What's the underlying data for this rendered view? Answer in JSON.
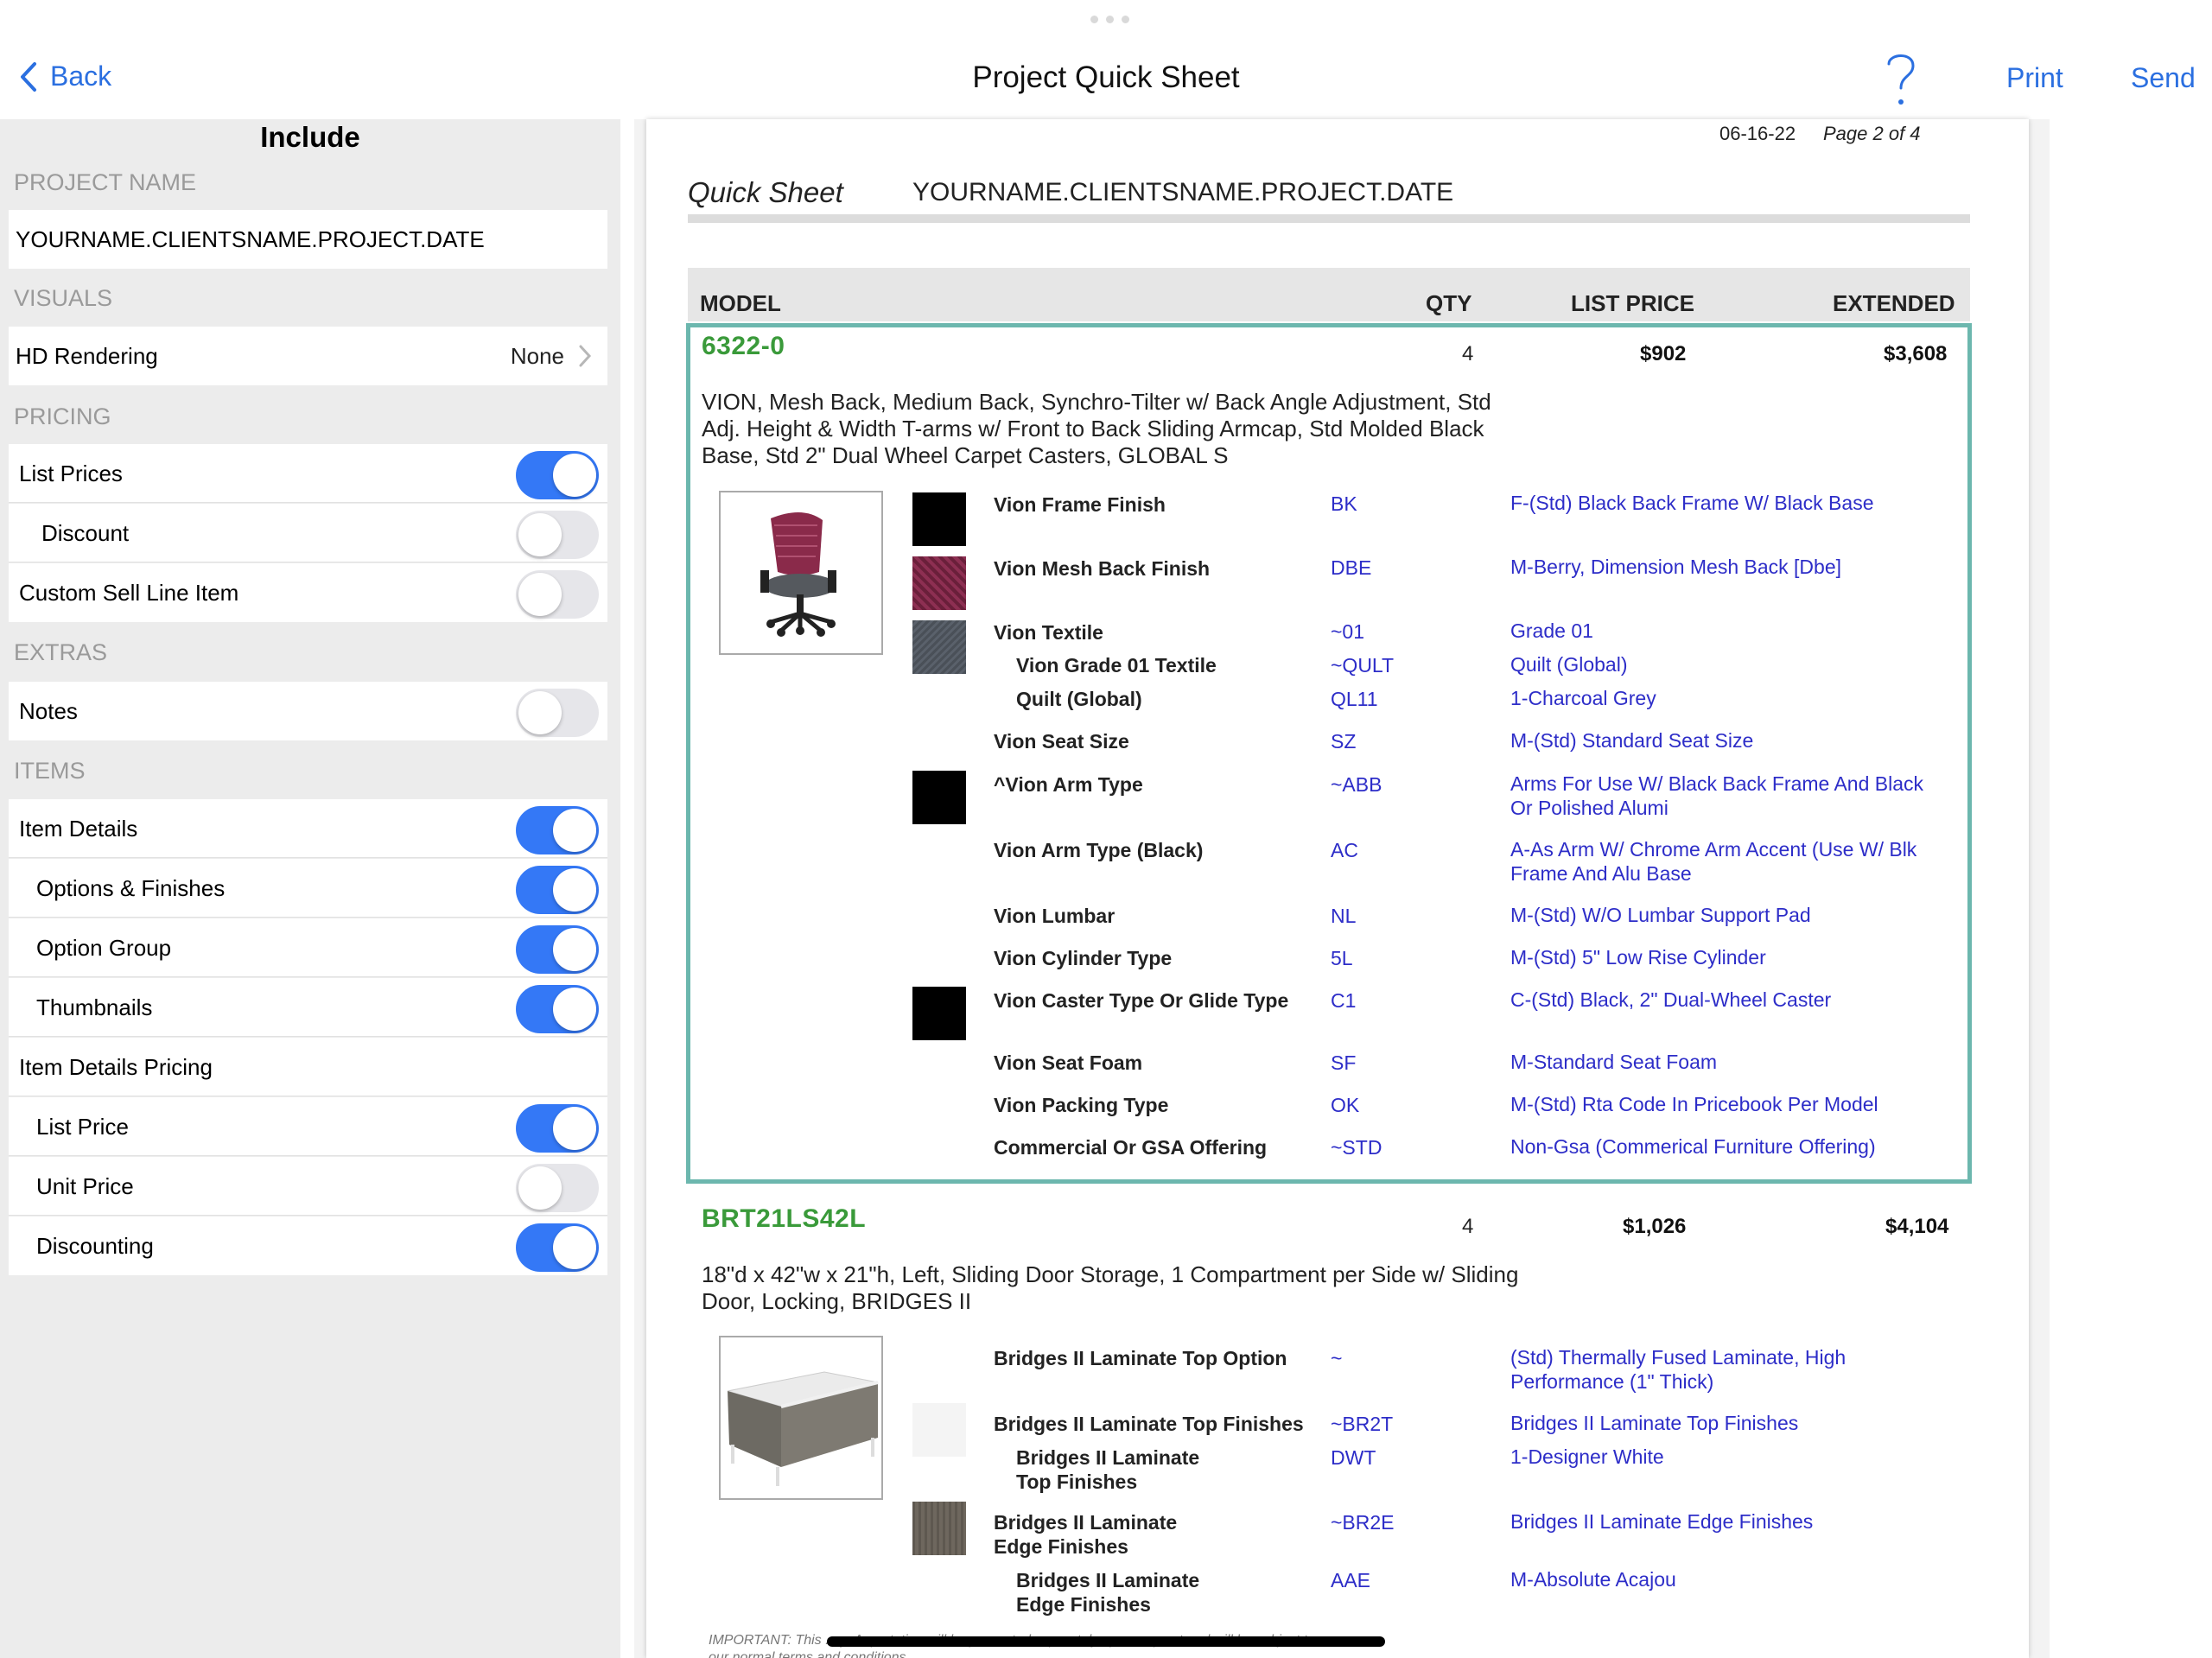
{
  "nav": {
    "back_label": "Back",
    "title": "Project Quick Sheet",
    "help_label": "?",
    "print_label": "Print",
    "send_label": "Send"
  },
  "panel": {
    "title": "Include",
    "project_name_header": "PROJECT NAME",
    "project_name": "YOURNAME.CLIENTSNAME.PROJECT.DATE",
    "visuals_header": "VISUALS",
    "hd_rendering_label": "HD Rendering",
    "hd_rendering_value": "None",
    "pricing_header": "PRICING",
    "list_prices_label": "List Prices",
    "list_prices_on": true,
    "discount_label": "Discount",
    "discount_on": false,
    "custom_sell_label": "Custom Sell Line Item",
    "custom_sell_on": false,
    "extras_header": "EXTRAS",
    "notes_label": "Notes",
    "notes_on": false,
    "items_header": "ITEMS",
    "item_details_label": "Item Details",
    "item_details_on": true,
    "options_finishes_label": "Options & Finishes",
    "options_finishes_on": true,
    "option_group_label": "Option Group",
    "option_group_on": true,
    "thumbnails_label": "Thumbnails",
    "thumbnails_on": true,
    "item_details_pricing_label": "Item Details Pricing",
    "list_price_label": "List Price",
    "list_price_on": true,
    "unit_price_label": "Unit Price",
    "unit_price_on": false,
    "discounting_label": "Discounting",
    "discounting_on": true
  },
  "doc": {
    "date": "06-16-22",
    "page": "Page 2 of 4",
    "qs_label": "Quick Sheet",
    "qs_name": "YOURNAME.CLIENTSNAME.PROJECT.DATE",
    "col_model": "MODEL",
    "col_qty": "QTY",
    "col_list": "LIST PRICE",
    "col_ext": "EXTENDED",
    "item1": {
      "model": "6322-0",
      "qty": "4",
      "list": "$902",
      "ext": "$3,608",
      "desc1": "VION, Mesh Back, Medium Back, Synchro-Tilter w/ Back Angle Adjustment, Std",
      "desc2": "Adj. Height & Width T-arms w/ Front to Back Sliding Armcap, Std Molded Black",
      "desc3": "Base, Std 2\" Dual Wheel Carpet Casters, GLOBAL S",
      "opts": [
        {
          "name": "Vion Frame Finish",
          "code": "BK",
          "val": "F-(Std) Black Back Frame W/ Black Base"
        },
        {
          "name": "Vion Mesh Back Finish",
          "code": "DBE",
          "val": "M-Berry, Dimension Mesh Back [Dbe]"
        },
        {
          "name": "Vion Textile",
          "code": "~01",
          "val": "Grade 01"
        },
        {
          "name": "Vion Grade 01 Textile",
          "code": "~QULT",
          "val": "Quilt (Global)"
        },
        {
          "name": "Quilt (Global)",
          "code": "QL11",
          "val": "1-Charcoal Grey"
        },
        {
          "name": "Vion Seat Size",
          "code": "SZ",
          "val": "M-(Std) Standard Seat Size"
        },
        {
          "name": "^Vion Arm Type",
          "code": "~ABB",
          "val": "Arms For Use W/ Black Back Frame And Black",
          "val2": "Or Polished Alumi"
        },
        {
          "name": "Vion Arm Type (Black)",
          "code": "AC",
          "val": "A-As Arm W/ Chrome Arm Accent (Use W/ Blk",
          "val2": "Frame And Alu Base"
        },
        {
          "name": "Vion Lumbar",
          "code": "NL",
          "val": "M-(Std) W/O Lumbar Support Pad"
        },
        {
          "name": "Vion Cylinder Type",
          "code": "5L",
          "val": "M-(Std) 5\" Low Rise Cylinder"
        },
        {
          "name": "Vion Caster Type Or Glide Type",
          "code": "C1",
          "val": "C-(Std) Black, 2\" Dual-Wheel Caster"
        },
        {
          "name": "Vion Seat Foam",
          "code": "SF",
          "val": "M-Standard Seat Foam"
        },
        {
          "name": "Vion Packing Type",
          "code": "OK",
          "val": "M-(Std) Rta Code In Pricebook Per Model"
        },
        {
          "name": "Commercial Or GSA Offering",
          "code": "~STD",
          "val": "Non-Gsa (Commerical Furniture Offering)"
        }
      ]
    },
    "item2": {
      "model": "BRT21LS42L",
      "qty": "4",
      "list": "$1,026",
      "ext": "$4,104",
      "desc1": "18\"d x 42\"w x 21\"h, Left, Sliding Door Storage, 1 Compartment per Side w/ Sliding",
      "desc2": "Door, Locking, BRIDGES II",
      "opts": [
        {
          "name": "Bridges II Laminate Top Option",
          "code": "~",
          "val": "(Std) Thermally Fused Laminate, High",
          "val2": "Performance (1\" Thick)"
        },
        {
          "name": "Bridges II Laminate Top Finishes",
          "code": "~BR2T",
          "val": "Bridges II Laminate Top Finishes"
        },
        {
          "name": "Bridges II Laminate",
          "name2": "Top Finishes",
          "code": "DWT",
          "val": "1-Designer White"
        },
        {
          "name": "Bridges II Laminate",
          "name2": "Edge Finishes",
          "code": "~BR2E",
          "val": "Bridges II Laminate Edge Finishes"
        },
        {
          "name": "Bridges II Laminate",
          "name2": "Edge Finishes",
          "code": "AAE",
          "val": "M-Absolute Acajou"
        }
      ]
    },
    "footnote": "IMPORTANT: This ... y. A quotation will be presented separately upon request and will be subject to",
    "footnote2": "our normal terms and conditions."
  },
  "colors": {
    "accent": "#3478f6",
    "link": "#2b6fe0",
    "item_border": "#6cb7ae",
    "model_green": "#3a9a3a",
    "value_blue": "#2d2dc8"
  }
}
